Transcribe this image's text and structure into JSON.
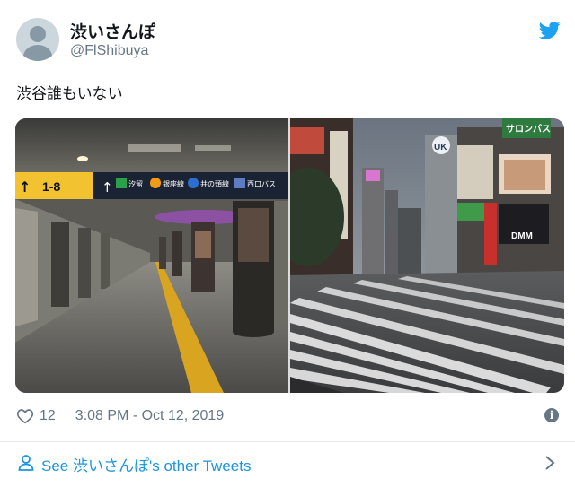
{
  "author": {
    "display_name": "渋いさんぽ",
    "handle": "@FlShibuya"
  },
  "tweet": {
    "text": "渋谷誰もいない"
  },
  "station_sign": {
    "exit_range": "1-8",
    "items": [
      "汐留",
      "銀座線",
      "井の頭線",
      "西口バス"
    ]
  },
  "street_signs": {
    "building_logo": "UK",
    "billboard_top": "サロンパス",
    "billboard_screen": "DMM"
  },
  "meta": {
    "like_count": "12",
    "timestamp": "3:08 PM - Oct 12, 2019"
  },
  "footer": {
    "link_text": "See 渋いさんぽ's other Tweets"
  },
  "colors": {
    "brand_blue": "#1da1f2",
    "link_blue": "#1b95e0",
    "secondary_text": "#657786"
  }
}
